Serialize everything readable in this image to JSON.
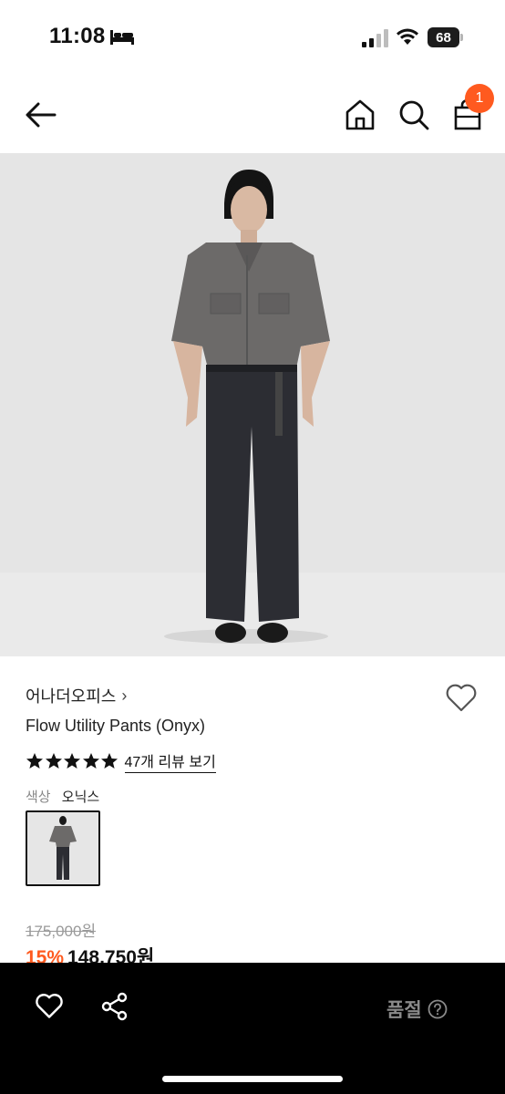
{
  "status_bar": {
    "time": "11:08",
    "battery": "68"
  },
  "top_nav": {
    "cart_count": "1"
  },
  "product": {
    "brand": "어나더오피스",
    "brand_chevron": "›",
    "name": "Flow Utility Pants (Onyx)",
    "rating_stars": 5,
    "review_link": "47개 리뷰 보기",
    "color_label": "색상",
    "color_value": "오닉스",
    "original_price": "175,000원",
    "discount": "15%",
    "sale_price": "148,750원"
  },
  "bottom_bar": {
    "soldout_label": "품절"
  },
  "icons": [
    "bed-icon",
    "signal-icon",
    "wifi-icon",
    "back-icon",
    "home-icon",
    "search-icon",
    "bag-icon",
    "heart-icon",
    "share-icon",
    "help-icon",
    "star-icon"
  ],
  "colors": {
    "accent": "#ff5a1f",
    "bottom_bar": "#000000",
    "soldout_text": "#8a8a8a"
  }
}
